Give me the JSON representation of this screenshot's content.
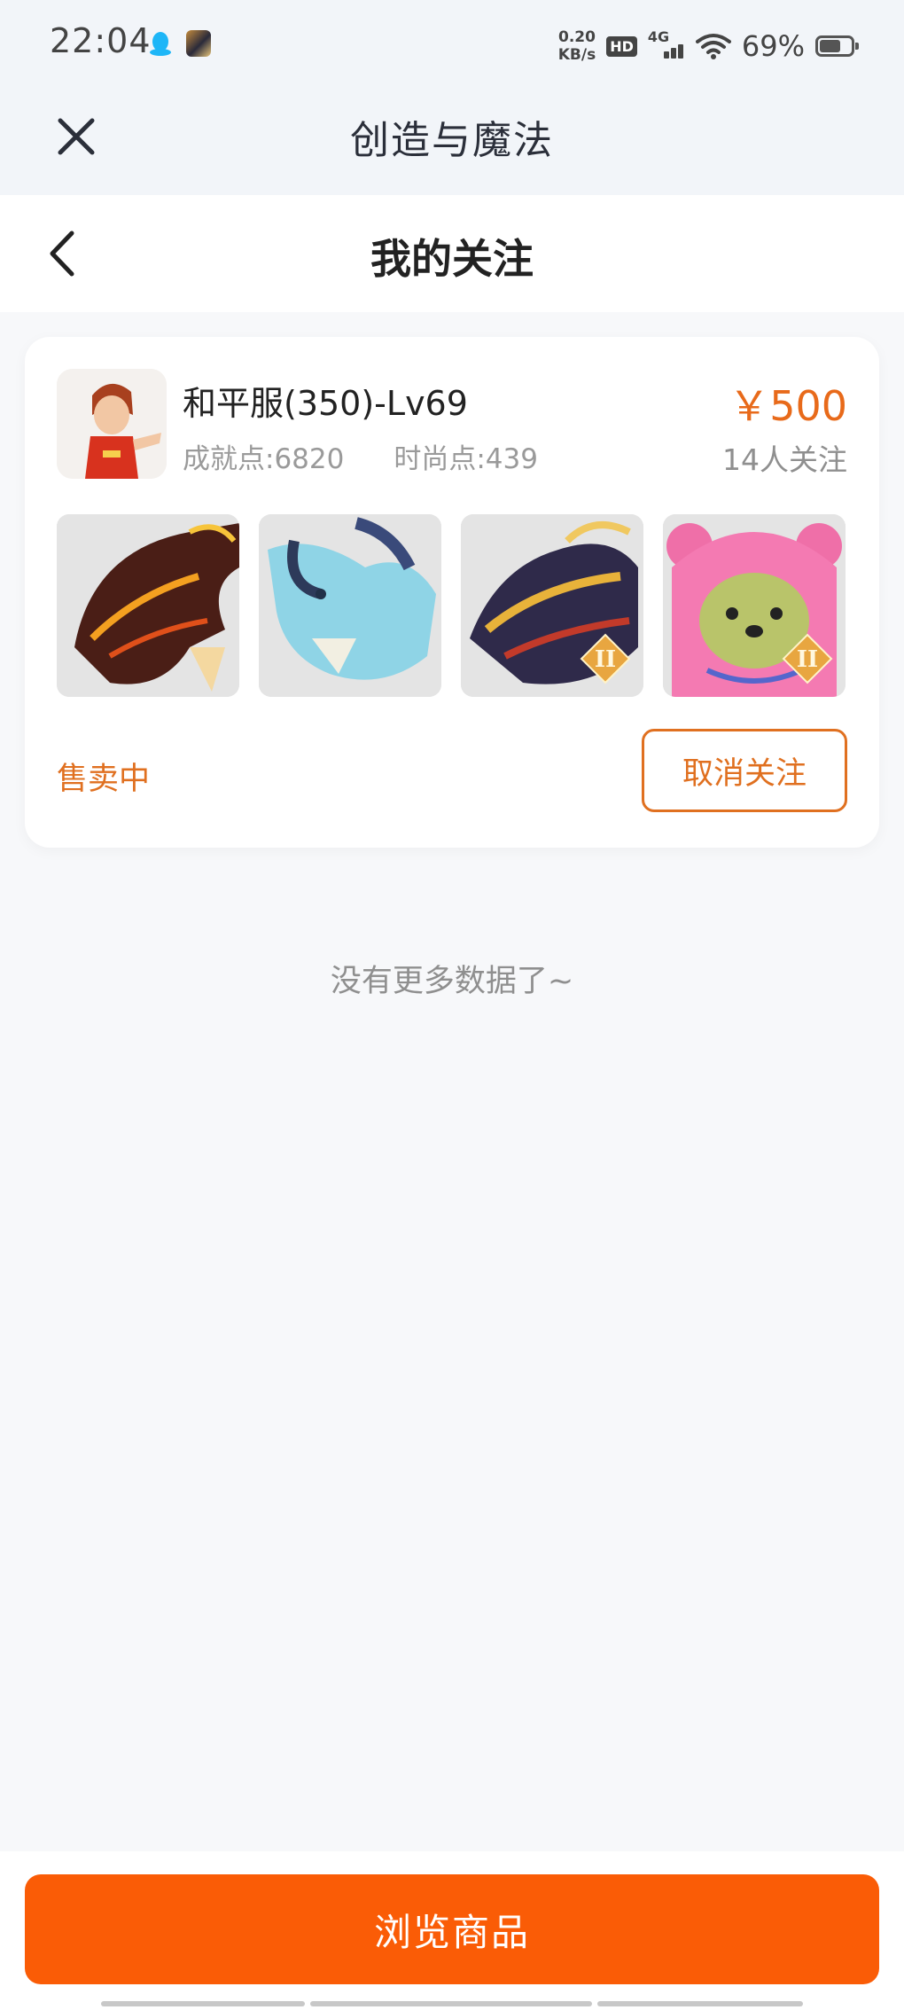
{
  "status_bar": {
    "time": "22:04",
    "speed_value": "0.20",
    "speed_unit": "KB/s",
    "hd": "HD",
    "network": "4G",
    "battery": "69%",
    "battery_level": 0.69,
    "icons": [
      "qq-icon",
      "app-icon",
      "hd-icon",
      "signal-icon",
      "wifi-icon",
      "battery-icon"
    ]
  },
  "app_header": {
    "title": "创造与魔法",
    "close_icon": "close-icon"
  },
  "page_header": {
    "title": "我的关注",
    "back_icon": "chevron-left-icon"
  },
  "card": {
    "name": "和平服(350)-Lv69",
    "achievement": "成就点:6820",
    "fashion": "时尚点:439",
    "price": "￥500",
    "followers": "14人关注",
    "status": "售卖中",
    "unfollow_label": "取消关注",
    "thumbnails": [
      {
        "name": "lava-dragon",
        "badge": ""
      },
      {
        "name": "ice-dragon",
        "badge": ""
      },
      {
        "name": "golden-dragon",
        "badge": "II"
      },
      {
        "name": "pink-bear",
        "badge": "II"
      }
    ]
  },
  "footer_note": "没有更多数据了~",
  "bottom": {
    "browse_label": "浏览商品"
  },
  "colors": {
    "accent": "#e07020",
    "primary_button": "#fa5c06",
    "header_bg": "#f2f5f9"
  }
}
